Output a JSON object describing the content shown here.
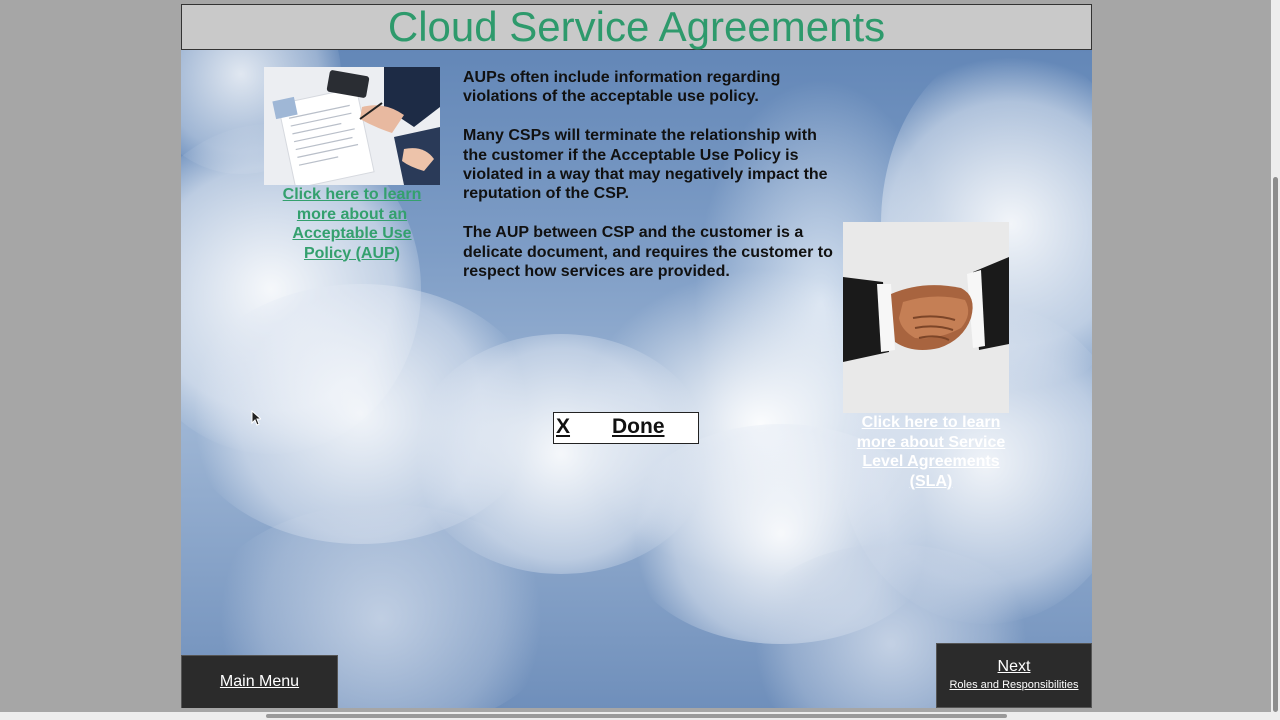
{
  "slide": {
    "title": "Cloud Service Agreements",
    "body_paragraphs": [
      "AUPs often include information regarding violations of the acceptable use policy.",
      "Many CSPs will terminate the relationship with the customer if the Acceptable Use Policy is violated in a way that may negatively impact the reputation of the CSP.",
      "The AUP between CSP and the customer is a delicate document, and requires the customer to respect how services are provided."
    ],
    "aup_link": "Click here to learn more about an Acceptable Use Policy (AUP)",
    "sla_link": "Click here to learn more about Service Level Agreements (SLA)",
    "done_box": {
      "close": "X",
      "done": "Done"
    },
    "nav": {
      "main_menu": "Main Menu",
      "next": "Next",
      "next_sub": "Roles and Responsibilities"
    }
  },
  "colors": {
    "title": "#2e9a6c",
    "aup_link": "#34a06e",
    "sla_link": "#ffffff",
    "title_bar": "#c9c9c9",
    "nav_button": "#2b2b2b"
  },
  "icons": {
    "cursor": "mouse-pointer-icon"
  }
}
